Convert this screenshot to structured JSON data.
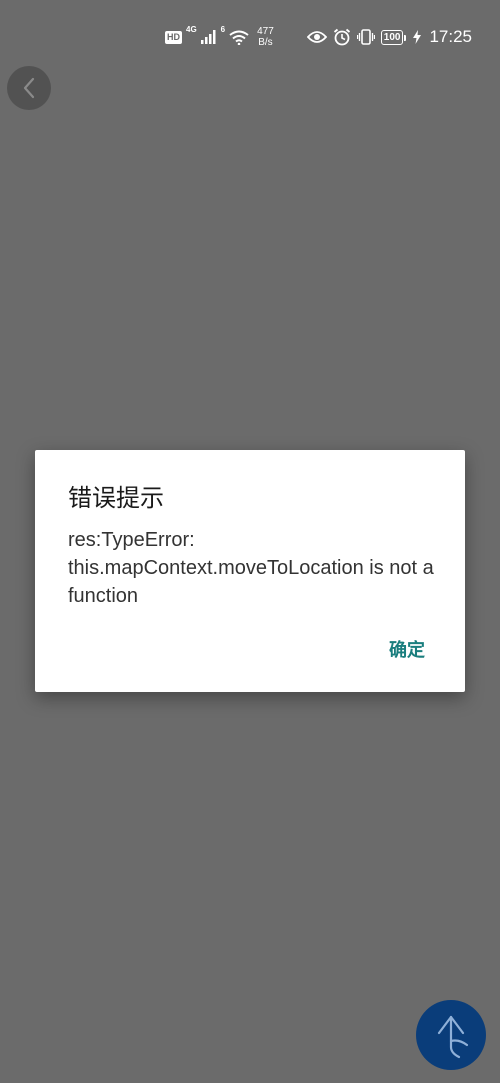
{
  "status_bar": {
    "hd": "HD",
    "network_4g": "4G",
    "wifi_tag": "6",
    "speed_value": "477",
    "speed_unit": "B/s",
    "battery": "100",
    "time": "17:25"
  },
  "dialog": {
    "title": "错误提示",
    "message": "res:TypeError: this.mapContext.moveToLocation is not a function",
    "confirm_label": "确定"
  },
  "icons": {
    "back": "chevron-left-icon",
    "fab": "navigation-arrow-icon",
    "eye": "eye-icon",
    "alarm": "alarm-icon",
    "vibrate": "vibrate-icon",
    "charging": "lightning-icon"
  },
  "colors": {
    "overlay": "#6b6b6b",
    "confirm": "#1a7e7e",
    "fab": "#0a3d7a"
  }
}
